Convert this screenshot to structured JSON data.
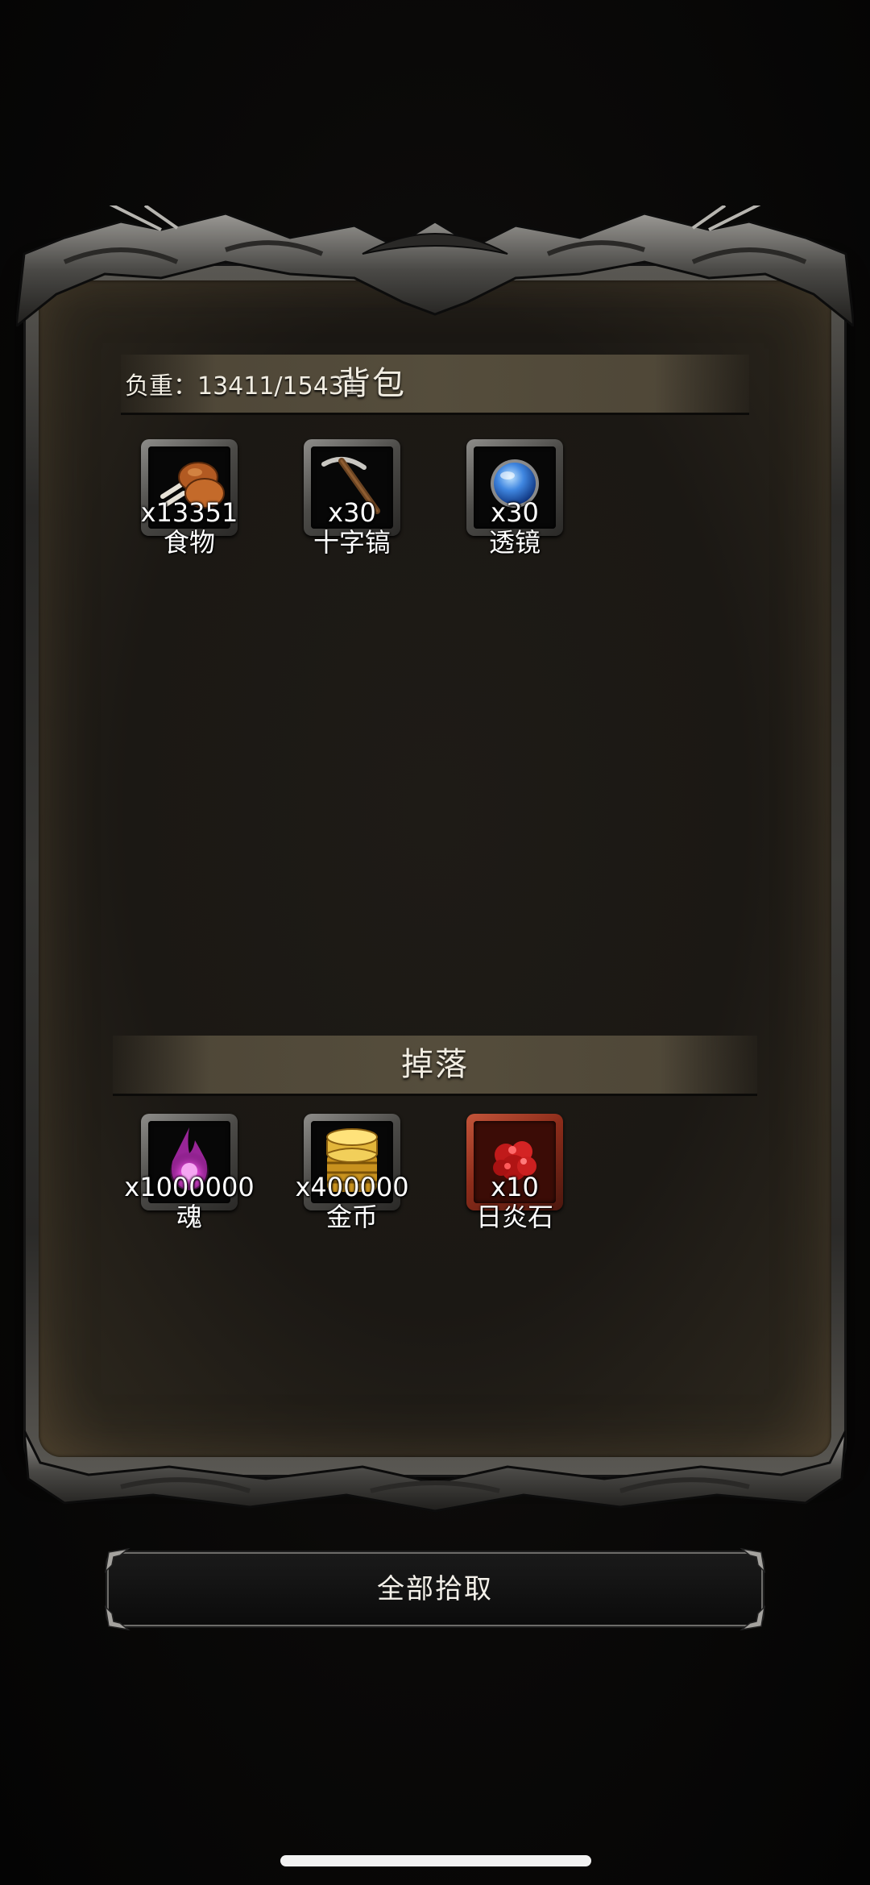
{
  "bag": {
    "title": "背包",
    "weight_label": "负重：13411/15431",
    "items": [
      {
        "name": "食物",
        "qty": "x13351",
        "icon": "food-icon"
      },
      {
        "name": "十字镐",
        "qty": "x30",
        "icon": "pickaxe-icon"
      },
      {
        "name": "透镜",
        "qty": "x30",
        "icon": "lens-icon"
      }
    ]
  },
  "drops": {
    "title": "掉落",
    "items": [
      {
        "name": "魂",
        "qty": "x1000000",
        "icon": "soul-icon"
      },
      {
        "name": "金币",
        "qty": "x400000",
        "icon": "gold-coin-icon"
      },
      {
        "name": "日炎石",
        "qty": "x10",
        "icon": "sun-flame-stone-icon"
      }
    ]
  },
  "actions": {
    "pickup_all": "全部拾取"
  },
  "colors": {
    "panel": "#1b1814",
    "header_bar": "#58503e",
    "rare_slot": "#8c2c1a"
  }
}
